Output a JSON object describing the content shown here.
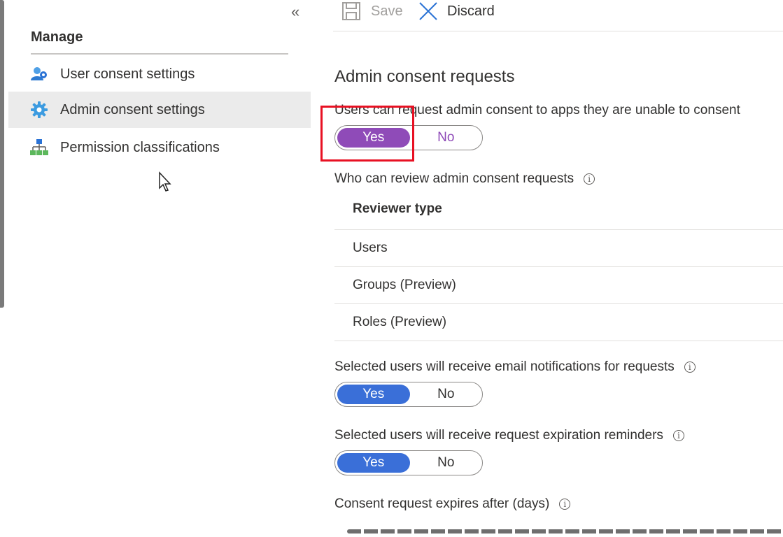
{
  "toolbar": {
    "save_label": "Save",
    "discard_label": "Discard"
  },
  "sidebar": {
    "heading": "Manage",
    "items": [
      {
        "label": "User consent settings",
        "icon": "user-gear-icon"
      },
      {
        "label": "Admin consent settings",
        "icon": "gear-icon",
        "selected": true
      },
      {
        "label": "Permission classifications",
        "icon": "hierarchy-icon"
      }
    ]
  },
  "main": {
    "title": "Admin consent requests",
    "request_consent": {
      "label": "Users can request admin consent to apps they are unable to consent",
      "yes": "Yes",
      "no": "No",
      "value": "Yes",
      "accent": "#8f4bb8"
    },
    "reviewers": {
      "label": "Who can review admin consent requests",
      "header": "Reviewer type",
      "rows": [
        "Users",
        "Groups (Preview)",
        "Roles (Preview)"
      ]
    },
    "email_notifications": {
      "label": "Selected users will receive email notifications for requests",
      "yes": "Yes",
      "no": "No",
      "value": "Yes",
      "accent": "#3a6fd8"
    },
    "expiration_reminders": {
      "label": "Selected users will receive request expiration reminders",
      "yes": "Yes",
      "no": "No",
      "value": "Yes",
      "accent": "#3a6fd8"
    },
    "expires_after": {
      "label": "Consent request expires after (days)"
    }
  },
  "colors": {
    "highlight": "#e81123",
    "toggle_on_purple": "#8f4bb8",
    "toggle_on_blue": "#3a6fd8"
  }
}
